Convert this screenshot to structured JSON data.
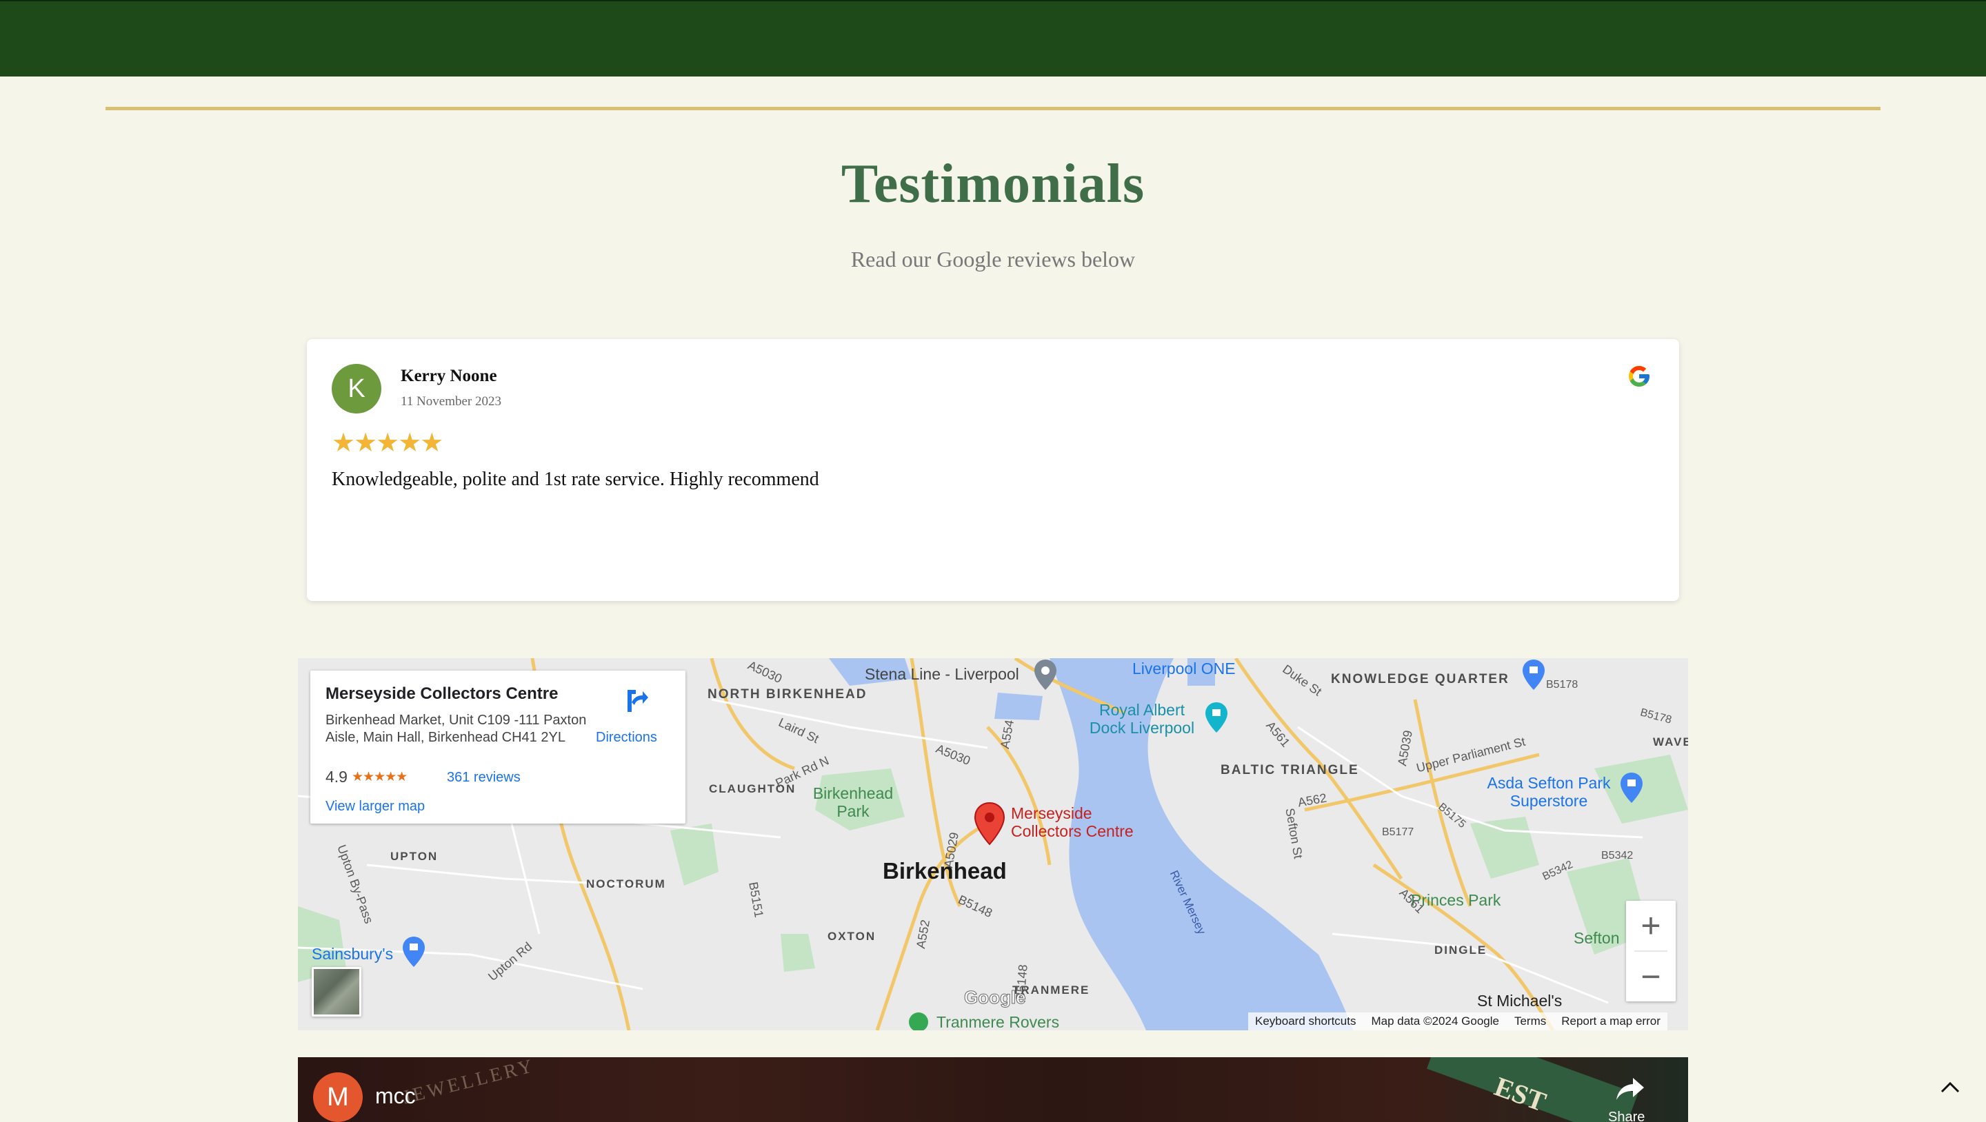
{
  "section": {
    "title": "Testimonials",
    "subtitle": "Read our Google reviews below"
  },
  "review": {
    "avatar_letter": "K",
    "author": "Kerry Noone",
    "date": "11 November 2023",
    "stars": "★★★★★",
    "rating": 5,
    "text": "Knowledgeable, polite and 1st rate service. Highly recommend",
    "source_icon": "google-icon"
  },
  "map": {
    "place_name": "Merseyside Collectors Centre",
    "address": "Birkenhead Market, Unit C109 -111 Paxton Aisle, Main Hall, Birkenhead CH41 2YL",
    "rating": "4.9",
    "rating_stars": "★★★★★",
    "reviews_link": "361 reviews",
    "larger_map_link": "View larger map",
    "directions_label": "Directions",
    "zoom_in": "+",
    "zoom_out": "−",
    "watermark": "Google",
    "footer": {
      "shortcuts": "Keyboard shortcuts",
      "data": "Map data ©2024 Google",
      "terms": "Terms",
      "report": "Report a map error"
    },
    "labels": {
      "north_birkenhead": "NORTH BIRKENHEAD",
      "knowledge_quarter": "KNOWLEDGE QUARTER",
      "baltic_triangle": "BALTIC TRIANGLE",
      "claughton": "CLAUGHTON",
      "upton": "UPTON",
      "noctorum": "NOCTORUM",
      "oxton": "OXTON",
      "tranmere": "TRANMERE",
      "dingle": "DINGLE",
      "wave": "WAVE",
      "birkenhead": "Birkenhead",
      "birkenhead_park": "Birkenhead Park",
      "stena_line": "Stena Line - Liverpool",
      "liverpool_one": "Liverpool ONE",
      "royal_albert_dock": "Royal Albert Dock Liverpool",
      "asda": "Asda Sefton Park Superstore",
      "princes_park": "Princes Park",
      "sefton": "Sefton",
      "st_michaels": "St Michael's",
      "sainsburys": "Sainsbury's",
      "tranmere_rovers": "Tranmere Rovers",
      "river_mersey": "River Mersey",
      "marker": "Merseyside Collectors Centre",
      "upper_parliament": "Upper Parliament St",
      "duke_st": "Duke St",
      "laird_st": "Laird St",
      "park_rd_n": "Park Rd N",
      "upton_rd": "Upton Rd",
      "upton_bypass": "Upton By-Pass",
      "a5030": "A5030",
      "a5030b": "A5030",
      "a554": "A554",
      "a5029": "A5029",
      "a552": "A552",
      "b5148": "B5148",
      "b5151": "B5151",
      "a561": "A561",
      "a562": "A562",
      "a5039": "A5039",
      "b5178": "B5178",
      "b5178b": "B5178",
      "b5175": "B5175",
      "b5177": "B5177",
      "b5342": "B5342",
      "b5342b": "B5342",
      "sefton_st": "Sefton St",
      "a561b": "A561",
      "b5148b": "B5148"
    }
  },
  "video": {
    "channel_letter": "M",
    "title": "mcc",
    "share_label": "Share"
  },
  "colors": {
    "header_green": "#1e4a1a",
    "gold_rule": "#d9bf72",
    "title_green": "#3f6e48",
    "star_gold": "#f2b535",
    "link_blue": "#1a73e8",
    "marker_red": "#ea4335"
  }
}
